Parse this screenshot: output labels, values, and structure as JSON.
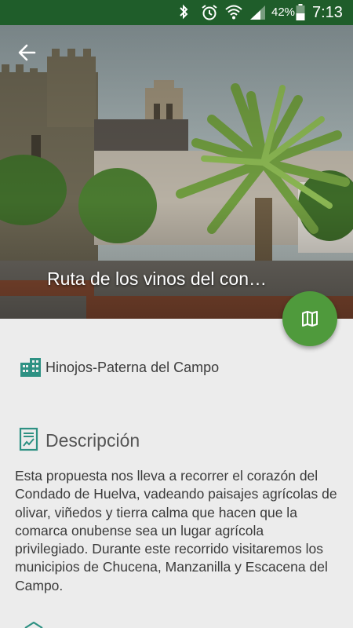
{
  "status_bar": {
    "battery_percent": "42%",
    "time": "7:13",
    "icons": [
      "bluetooth-icon",
      "alarm-icon",
      "wifi-icon",
      "signal-icon",
      "battery-icon"
    ]
  },
  "header": {
    "title": "Ruta de los vinos del con…",
    "back_icon": "arrow-left-icon",
    "fab_icon": "map-icon"
  },
  "location": {
    "icon": "city-buildings-icon",
    "text": "Hinojos-Paterna del Campo"
  },
  "description": {
    "icon": "document-chart-icon",
    "title": "Descripción",
    "body": "Esta propuesta nos lleva a recorrer el corazón del Condado de Huelva, vadeando paisajes agrícolas de olivar, viñedos y tierra calma que hacen que la comarca onubense sea un lugar agrícola privilegiado. Durante este recorrido visitaremos los municipios de Chucena, Manzanilla y Escacena del Campo."
  },
  "colors": {
    "status_bar": "#1f5d2a",
    "accent": "#4f9a3c",
    "icon_teal": "#2e9183",
    "background": "#ececec"
  }
}
